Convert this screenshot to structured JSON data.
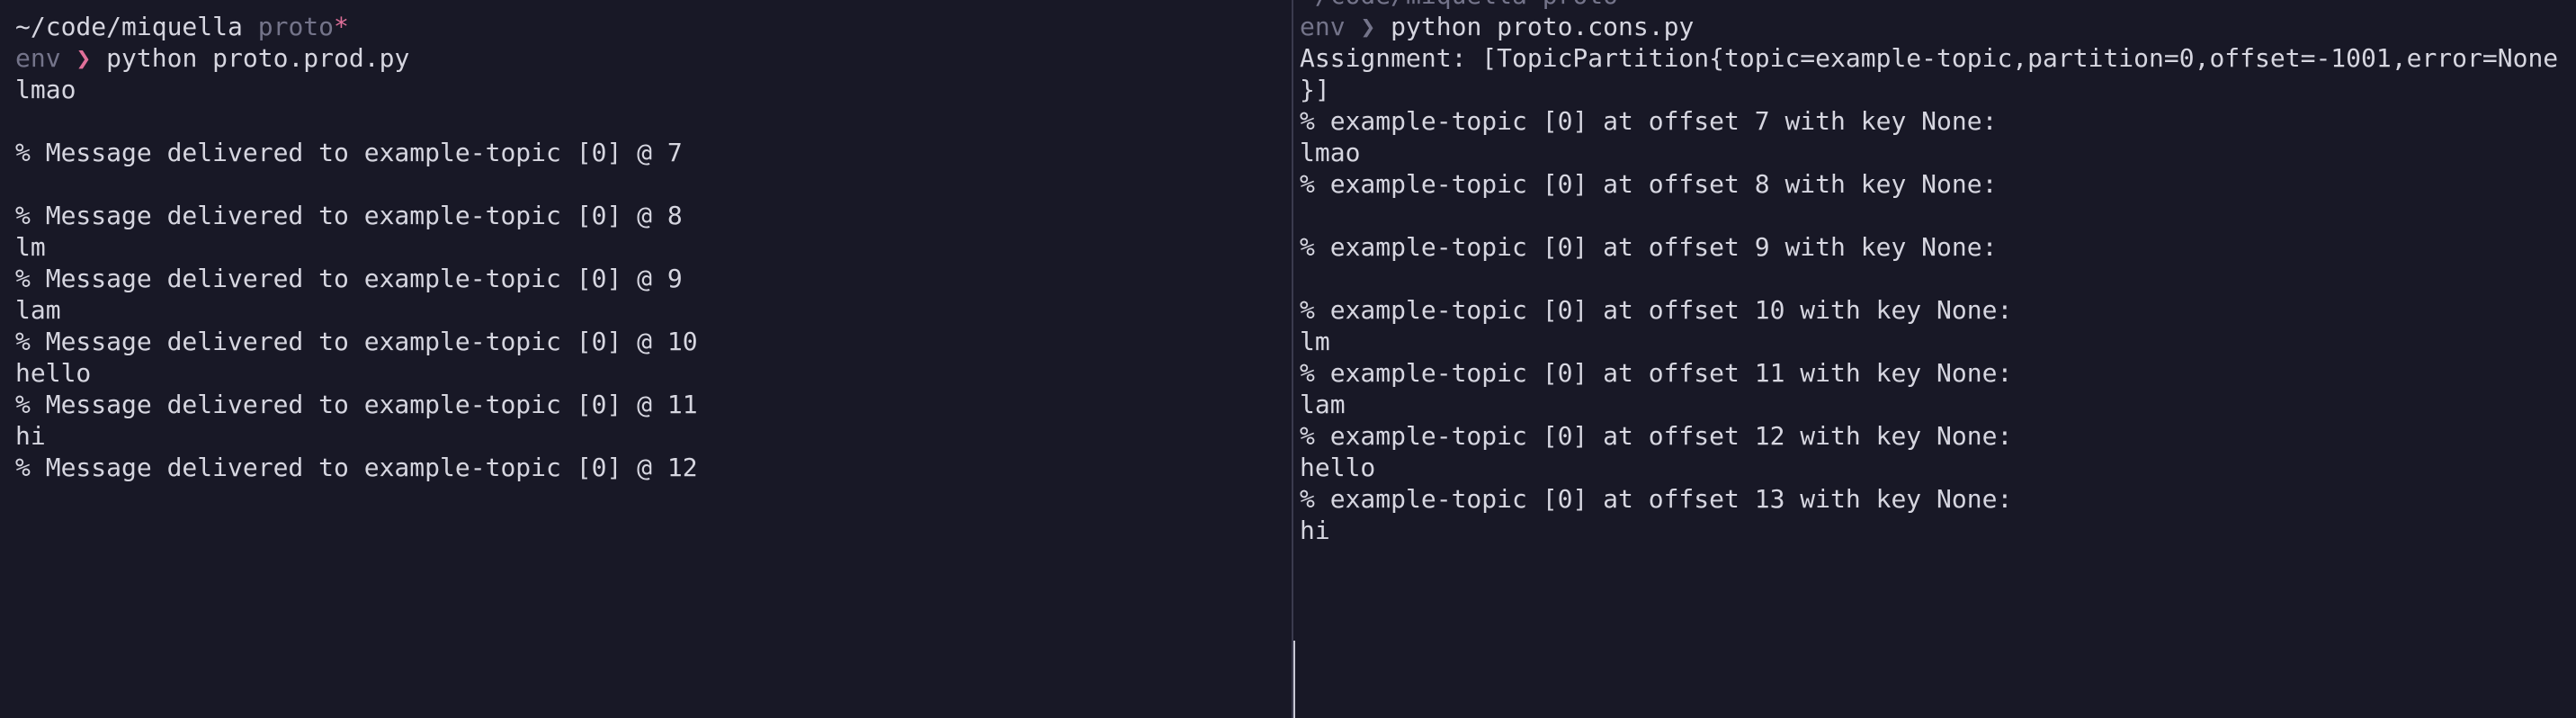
{
  "colors": {
    "background": "#181826",
    "foreground": "#d6d6e0",
    "dim": "#74748a",
    "accent": "#e0709a",
    "divider": "#3a3a4e"
  },
  "left_pane": {
    "prompt_path": "~/code/miquella",
    "prompt_branch": "proto",
    "prompt_dirty": "*",
    "venv": "env",
    "chevron": "❯",
    "command": "python proto.prod.py",
    "output": [
      "lmao",
      "",
      "% Message delivered to example-topic [0] @ 7",
      "",
      "% Message delivered to example-topic [0] @ 8",
      "lm",
      "% Message delivered to example-topic [0] @ 9",
      "lam",
      "% Message delivered to example-topic [0] @ 10",
      "hello",
      "% Message delivered to example-topic [0] @ 11",
      "hi",
      "% Message delivered to example-topic [0] @ 12"
    ]
  },
  "right_pane": {
    "prompt_path": "~/code/miquella",
    "prompt_branch": "proto",
    "venv": "env",
    "chevron": "❯",
    "command": "python proto.cons.py",
    "output": [
      "Assignment: [TopicPartition{topic=example-topic,partition=0,offset=-1001,error=None",
      "}]",
      "% example-topic [0] at offset 7 with key None:",
      "lmao",
      "% example-topic [0] at offset 8 with key None:",
      "",
      "% example-topic [0] at offset 9 with key None:",
      "",
      "% example-topic [0] at offset 10 with key None:",
      "lm",
      "% example-topic [0] at offset 11 with key None:",
      "lam",
      "% example-topic [0] at offset 12 with key None:",
      "hello",
      "% example-topic [0] at offset 13 with key None:",
      "hi"
    ]
  }
}
